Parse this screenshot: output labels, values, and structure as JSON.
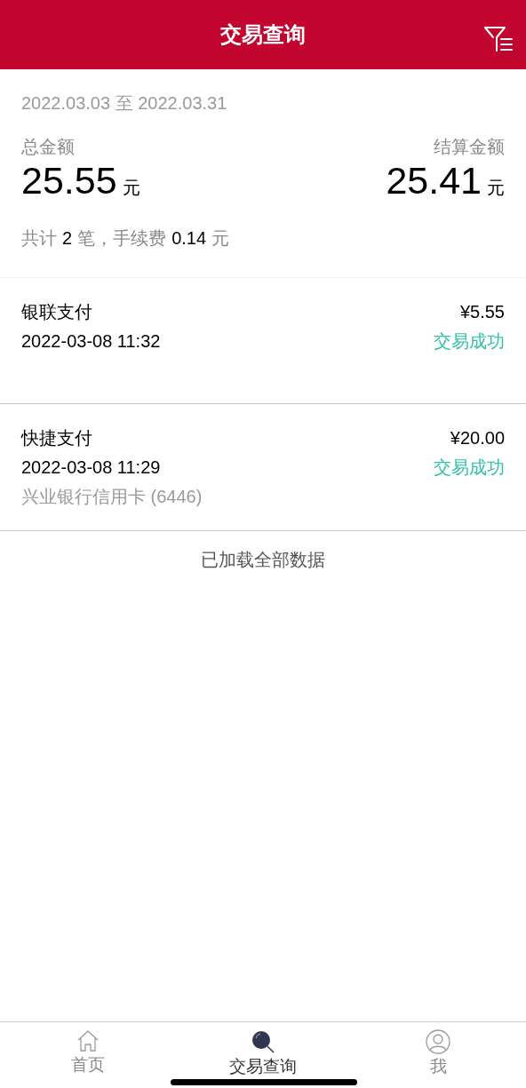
{
  "header": {
    "title": "交易查询"
  },
  "summary": {
    "date_range": "2022.03.03 至 2022.03.31",
    "total_label": "总金额",
    "total_amount": "25.55",
    "total_unit": "元",
    "settled_label": "结算金额",
    "settled_amount": "25.41",
    "settled_unit": "元",
    "count_prefix": "共计",
    "count": "2",
    "count_suffix": "笔，手续费",
    "fee": "0.14",
    "fee_unit": "元"
  },
  "transactions": [
    {
      "method": "银联支付",
      "time": "2022-03-08 11:32",
      "amount": "¥5.55",
      "status": "交易成功"
    },
    {
      "method": "快捷支付",
      "time": "2022-03-08 11:29",
      "card": "兴业银行信用卡 (6446)",
      "amount": "¥20.00",
      "status": "交易成功"
    }
  ],
  "footer_note": "已加载全部数据",
  "tab_bar": [
    {
      "label": "首页",
      "kind": "home",
      "selected": false
    },
    {
      "label": "交易查询",
      "kind": "search",
      "selected": true
    },
    {
      "label": "我",
      "kind": "profile",
      "selected": false
    }
  ]
}
